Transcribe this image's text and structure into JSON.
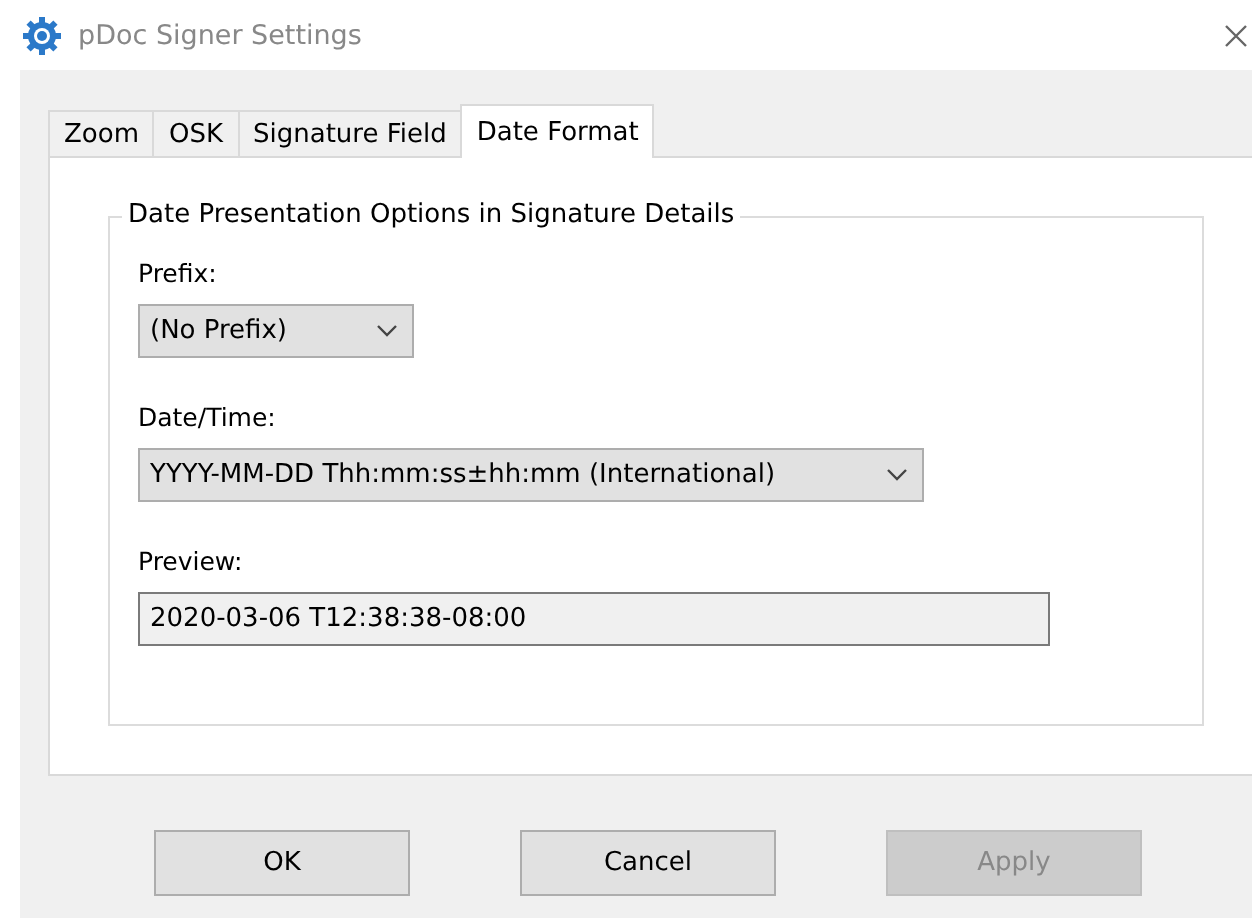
{
  "window": {
    "title": "pDoc Signer Settings"
  },
  "tabs": [
    {
      "label": "Zoom",
      "selected": false
    },
    {
      "label": "OSK",
      "selected": false
    },
    {
      "label": "Signature Field",
      "selected": false
    },
    {
      "label": "Date Format",
      "selected": true
    }
  ],
  "group": {
    "title": "Date Presentation Options in Signature Details",
    "fields": [
      {
        "kind": "dropdown",
        "label": "Prefix:",
        "value": "(No Prefix)"
      },
      {
        "kind": "dropdown",
        "label": "Date/Time:",
        "value": "YYYY-MM-DD Thh:mm:ss±hh:mm (International)"
      },
      {
        "kind": "readonly",
        "label": "Preview:",
        "value": "2020-03-06 T12:38:38-08:00"
      }
    ]
  },
  "buttons": [
    {
      "label": "OK",
      "disabled": false
    },
    {
      "label": "Cancel",
      "disabled": false
    },
    {
      "label": "Apply",
      "disabled": true
    }
  ]
}
